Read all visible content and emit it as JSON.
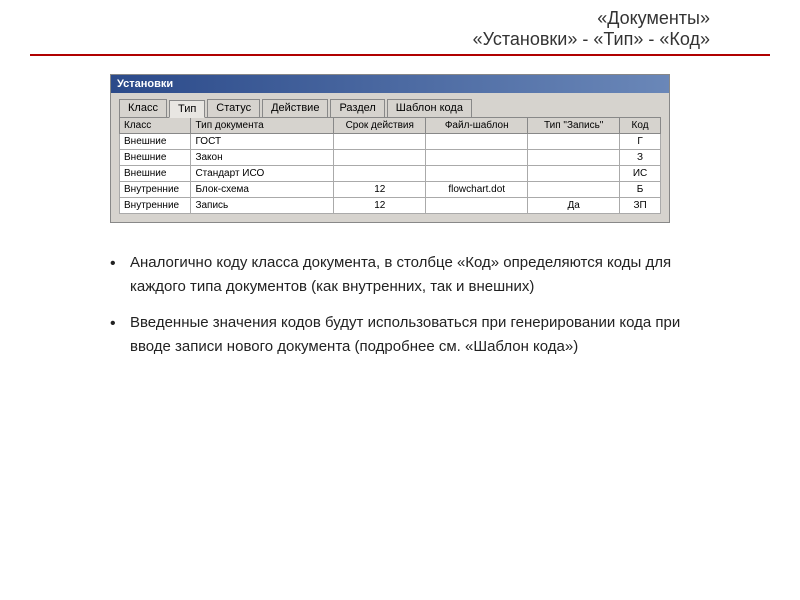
{
  "header": {
    "title": "«Документы»",
    "subtitle": "«Установки» - «Тип» - «Код»"
  },
  "window": {
    "titlebar": "Установки",
    "tabs": [
      {
        "label": "Класс",
        "active": false
      },
      {
        "label": "Тип",
        "active": true
      },
      {
        "label": "Статус",
        "active": false
      },
      {
        "label": "Действие",
        "active": false
      },
      {
        "label": "Раздел",
        "active": false
      },
      {
        "label": "Шаблон кода",
        "active": false
      }
    ],
    "columns": [
      "Класс",
      "Тип документа",
      "Срок действия",
      "Файл-шаблон",
      "Тип \"Запись\"",
      "Код"
    ],
    "rows": [
      {
        "klass": "Внешние",
        "doctype": "ГОСТ",
        "srok": "",
        "file": "",
        "zapis": "",
        "kod": "Г"
      },
      {
        "klass": "Внешние",
        "doctype": "Закон",
        "srok": "",
        "file": "",
        "zapis": "",
        "kod": "З"
      },
      {
        "klass": "Внешние",
        "doctype": "Стандарт ИСО",
        "srok": "",
        "file": "",
        "zapis": "",
        "kod": "ИС"
      },
      {
        "klass": "Внутренние",
        "doctype": "Блок-схема",
        "srok": "12",
        "file": "flowchart.dot",
        "zapis": "",
        "kod": "Б"
      },
      {
        "klass": "Внутренние",
        "doctype": "Запись",
        "srok": "12",
        "file": "",
        "zapis": "Да",
        "kod": "ЗП"
      }
    ]
  },
  "bullets": [
    "Аналогично коду класса документа, в столбце «Код» определяются коды для каждого типа документов (как внутренних, так и внешних)",
    "Введенные значения кодов будут использоваться при генерировании кода при вводе записи нового документа (подробнее см. «Шаблон кода»)"
  ]
}
